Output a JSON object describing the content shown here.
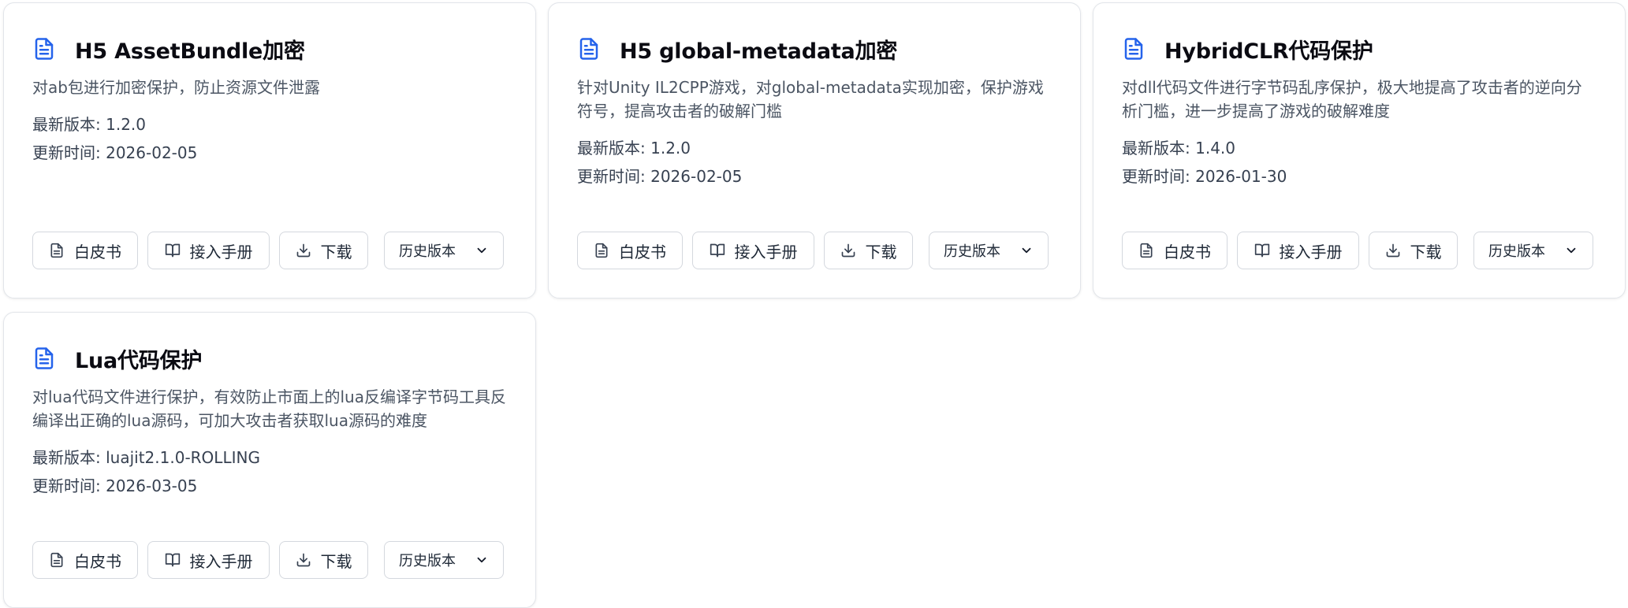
{
  "labels": {
    "version_prefix": "最新版本: ",
    "date_prefix": "更新时间: ",
    "whitepaper": "白皮书",
    "manual": "接入手册",
    "download": "下载",
    "history": "历史版本"
  },
  "accent_color": "#2563eb",
  "icons": {
    "card": "file-text-icon",
    "whitepaper": "file-icon",
    "manual": "book-open-icon",
    "download": "download-icon",
    "history": "chevron-down-icon"
  },
  "cards": [
    {
      "title": "H5 AssetBundle加密",
      "description": "对ab包进行加密保护，防止资源文件泄露",
      "version": "1.2.0",
      "updated": "2026-02-05"
    },
    {
      "title": "H5 global-metadata加密",
      "description": "针对Unity IL2CPP游戏，对global-metadata实现加密，保护游戏符号，提高攻击者的破解门槛",
      "version": "1.2.0",
      "updated": "2026-02-05"
    },
    {
      "title": "HybridCLR代码保护",
      "description": "对dll代码文件进行字节码乱序保护，极大地提高了攻击者的逆向分析门槛，进一步提高了游戏的破解难度",
      "version": "1.4.0",
      "updated": "2026-01-30"
    },
    {
      "title": "Lua代码保护",
      "description": "对lua代码文件进行保护，有效防止市面上的lua反编译字节码工具反编译出正确的lua源码，可加大攻击者获取lua源码的难度",
      "version": "luajit2.1.0-ROLLING",
      "updated": "2026-03-05"
    }
  ]
}
